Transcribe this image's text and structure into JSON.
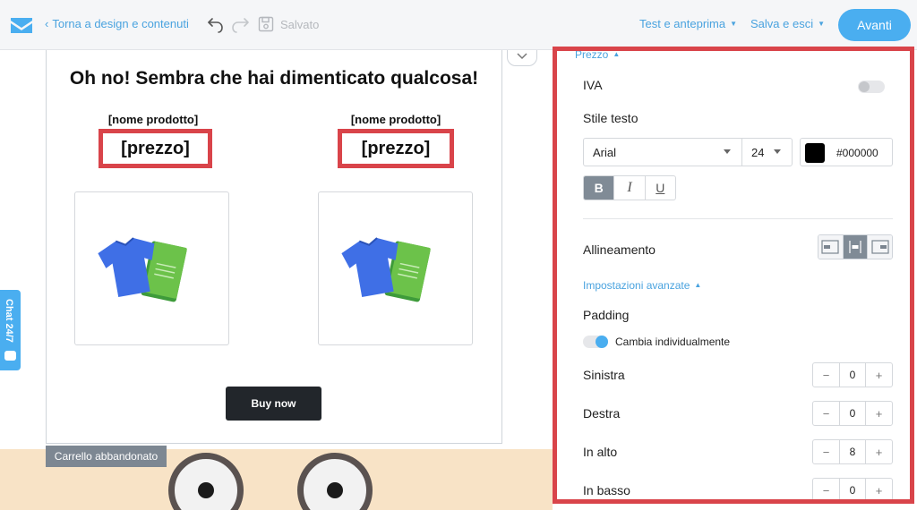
{
  "header": {
    "back_label": "Torna a design e contenuti",
    "saved_label": "Salvato",
    "test_label": "Test e anteprima",
    "save_exit_label": "Salva e esci",
    "next_label": "Avanti"
  },
  "email": {
    "title": "Oh no! Sembra che hai dimenticato qualcosa!",
    "products": [
      {
        "name": "[nome prodotto]",
        "price": "[prezzo]"
      },
      {
        "name": "[nome prodotto]",
        "price": "[prezzo]"
      }
    ],
    "buy_label": "Buy now",
    "section_tag": "Carrello abbandonato"
  },
  "chat": {
    "label": "Chat 24/7"
  },
  "panel": {
    "section_title": "Prezzo",
    "iva_label": "IVA",
    "text_style_label": "Stile testo",
    "font": "Arial",
    "font_size": "24",
    "color_hex": "#000000",
    "format": {
      "bold": "B",
      "italic": "I",
      "underline": "U"
    },
    "alignment_label": "Allineamento",
    "advanced_label": "Impostazioni avanzate",
    "padding_label": "Padding",
    "individual_label": "Cambia individualmente",
    "paddings": [
      {
        "label": "Sinistra",
        "value": "0"
      },
      {
        "label": "Destra",
        "value": "0"
      },
      {
        "label": "In alto",
        "value": "8"
      },
      {
        "label": "In basso",
        "value": "0"
      }
    ],
    "stepper_minus": "−",
    "stepper_plus": "+"
  },
  "colors": {
    "accent": "#4aaef0",
    "highlight_border": "#d9444a",
    "buy_button": "#22262b",
    "swatch": "#000000"
  },
  "icons": {
    "logo": "envelope-logo-icon",
    "undo": "undo-icon",
    "redo": "redo-icon",
    "save": "save-icon",
    "product": "tshirt-book-icon",
    "chat": "chat-bubble-icon"
  }
}
